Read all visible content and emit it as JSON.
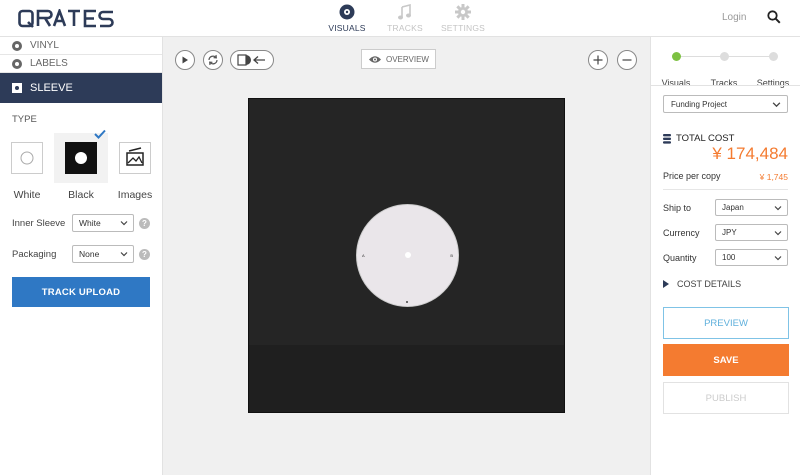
{
  "brand": {
    "logo_text": "QRATES"
  },
  "nav": {
    "items": [
      {
        "label": "VISUALS",
        "icon": "disc-icon",
        "active": true
      },
      {
        "label": "TRACKS",
        "icon": "music-note-icon",
        "active": false
      },
      {
        "label": "SETTINGS",
        "icon": "gear-icon",
        "active": false
      }
    ]
  },
  "header": {
    "login_label": "Login",
    "search_icon": "search-icon"
  },
  "sidebar": {
    "sections": [
      {
        "label": "VINYL"
      },
      {
        "label": "LABELS"
      }
    ],
    "active_section": "SLEEVE",
    "type_label": "TYPE",
    "types": [
      {
        "label": "White",
        "selected": false
      },
      {
        "label": "Black",
        "selected": true
      },
      {
        "label": "Images",
        "selected": false
      }
    ],
    "inner_sleeve": {
      "label": "Inner Sleeve",
      "value": "White"
    },
    "packaging": {
      "label": "Packaging",
      "value": "None"
    },
    "help_glyph": "?",
    "upload_label": "TRACK UPLOAD"
  },
  "canvas": {
    "overview_label": "OVERVIEW",
    "side_a": "A",
    "side_b": "B"
  },
  "order": {
    "steps": [
      {
        "label": "Visuals",
        "done": true
      },
      {
        "label": "Tracks",
        "done": false
      },
      {
        "label": "Settings",
        "done": false
      }
    ],
    "project_type": "Funding Project",
    "total_cost_label": "TOTAL COST",
    "total_cost_value": "¥ 174,484",
    "price_per_copy_label": "Price per copy",
    "price_per_copy_value": "¥ 1,745",
    "ship_to": {
      "label": "Ship to",
      "value": "Japan"
    },
    "currency": {
      "label": "Currency",
      "value": "JPY"
    },
    "quantity": {
      "label": "Quantity",
      "value": "100"
    },
    "cost_details_label": "COST DETAILS",
    "preview_label": "PREVIEW",
    "save_label": "SAVE",
    "publish_label": "PUBLISH"
  },
  "colors": {
    "navy": "#2d3b58",
    "accent_orange": "#f47b30",
    "upload_blue": "#2f78c4",
    "step_done_green": "#7dc142",
    "preview_blue": "#5fb0dc"
  }
}
